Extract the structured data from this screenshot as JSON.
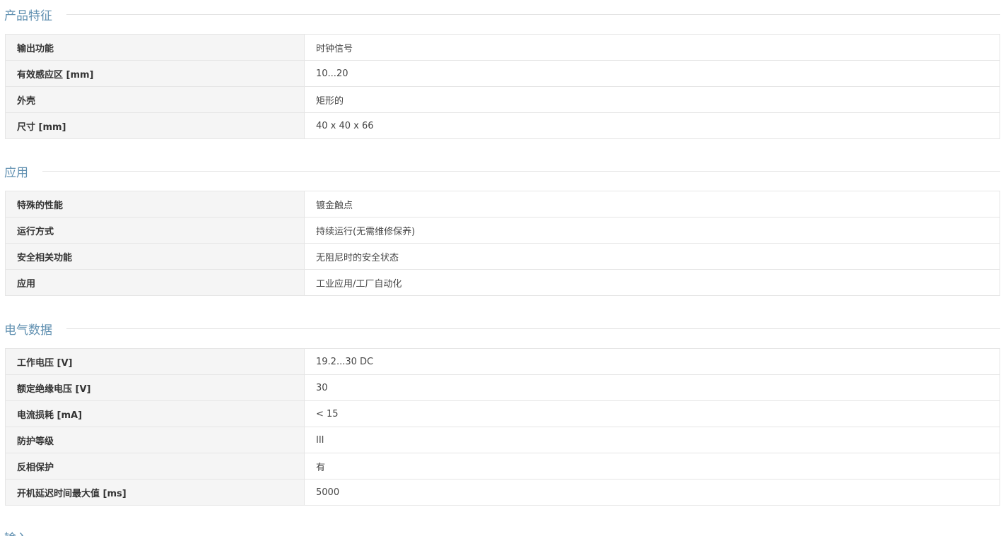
{
  "sections": [
    {
      "title": "产品特征",
      "rows": [
        {
          "label": "输出功能",
          "value": "时钟信号"
        },
        {
          "label": "有效感应区 [mm]",
          "value": "10...20"
        },
        {
          "label": "外壳",
          "value": "矩形的"
        },
        {
          "label": "尺寸 [mm]",
          "value": "40 x 40 x 66"
        }
      ]
    },
    {
      "title": "应用",
      "rows": [
        {
          "label": "特殊的性能",
          "value": "镀金触点"
        },
        {
          "label": "运行方式",
          "value": "持续运行(无需维修保养)"
        },
        {
          "label": "安全相关功能",
          "value": "无阻尼时的安全状态"
        },
        {
          "label": "应用",
          "value": "工业应用/工厂自动化"
        }
      ]
    },
    {
      "title": "电气数据",
      "rows": [
        {
          "label": "工作电压 [V]",
          "value": "19.2...30 DC"
        },
        {
          "label": "额定绝缘电压 [V]",
          "value": "30"
        },
        {
          "label": "电流损耗 [mA]",
          "value": "< 15"
        },
        {
          "label": "防护等级",
          "value": "III"
        },
        {
          "label": "反相保护",
          "value": "有"
        },
        {
          "label": "开机延迟时间最大值 [ms]",
          "value": "5000"
        }
      ]
    },
    {
      "title": "输入",
      "rows": []
    }
  ],
  "colors": {
    "section_title": "#5f8fb0",
    "label_background": "#f5f5f5",
    "border": "#e6e6e6"
  }
}
